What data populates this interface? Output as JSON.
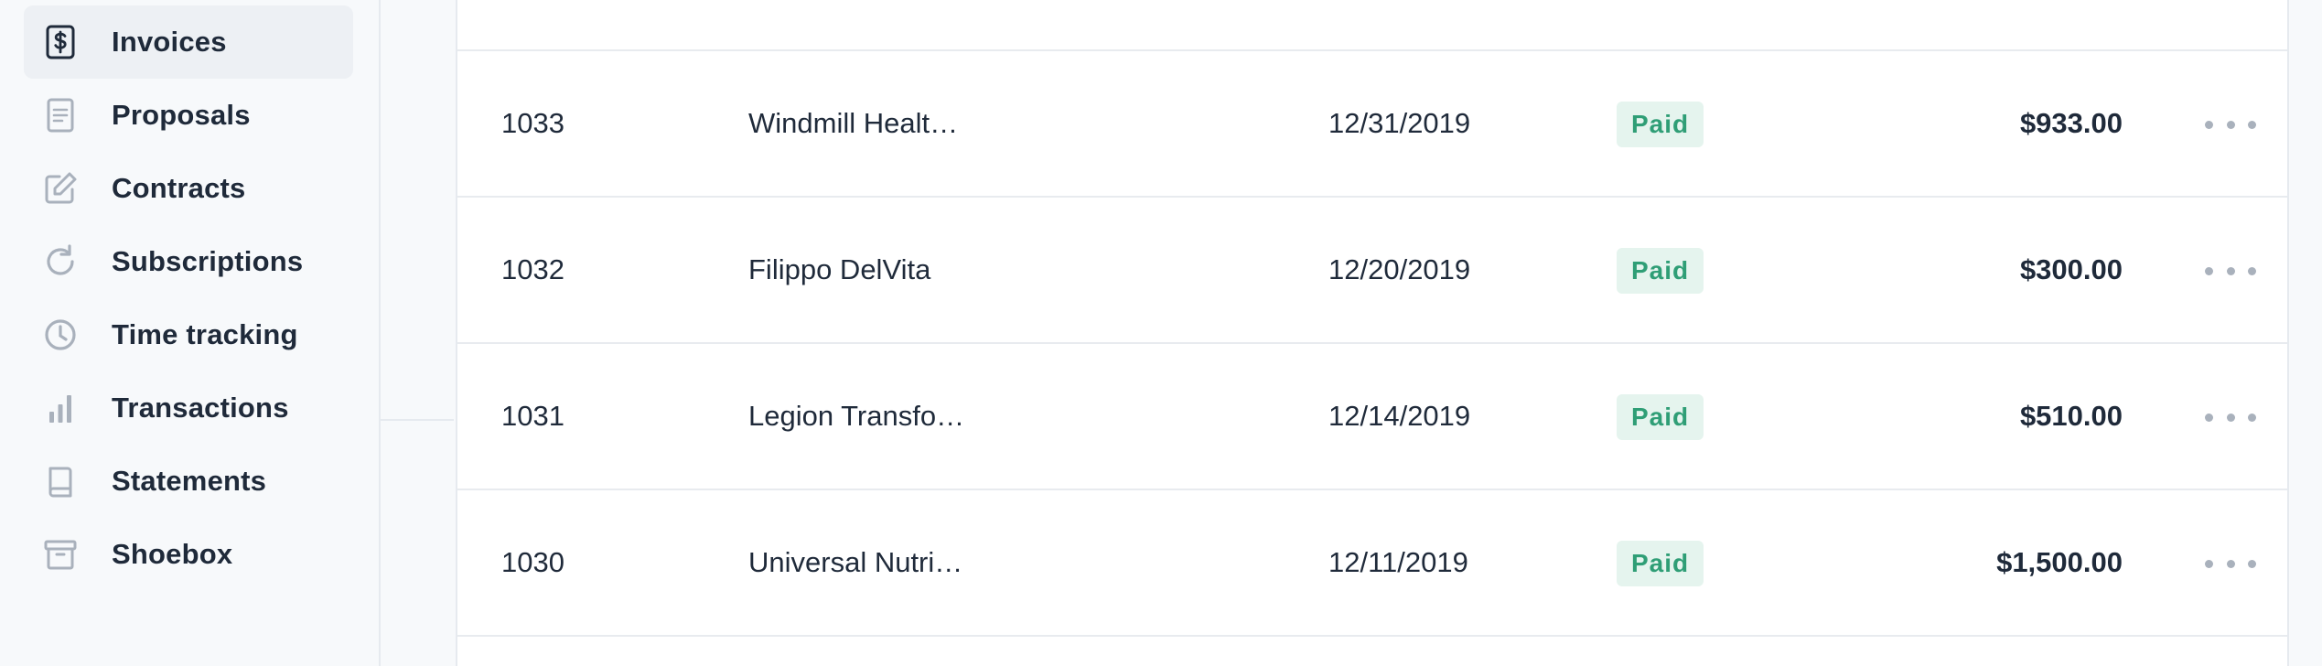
{
  "sidebar": {
    "items": [
      {
        "label": "Invoices",
        "icon": "dollar-document-icon",
        "active": true
      },
      {
        "label": "Proposals",
        "icon": "document-icon",
        "active": false
      },
      {
        "label": "Contracts",
        "icon": "edit-icon",
        "active": false
      },
      {
        "label": "Subscriptions",
        "icon": "refresh-icon",
        "active": false
      },
      {
        "label": "Time tracking",
        "icon": "clock-icon",
        "active": false
      },
      {
        "label": "Transactions",
        "icon": "bar-chart-icon",
        "active": false
      },
      {
        "label": "Statements",
        "icon": "book-icon",
        "active": false
      },
      {
        "label": "Shoebox",
        "icon": "archive-box-icon",
        "active": false
      }
    ]
  },
  "invoices": {
    "rows": [
      {
        "id": "1033",
        "client": "Windmill Healt…",
        "date": "12/31/2019",
        "status": "Paid",
        "amount": "$933.00"
      },
      {
        "id": "1032",
        "client": "Filippo DelVita",
        "date": "12/20/2019",
        "status": "Paid",
        "amount": "$300.00"
      },
      {
        "id": "1031",
        "client": "Legion Transfo…",
        "date": "12/14/2019",
        "status": "Paid",
        "amount": "$510.00"
      },
      {
        "id": "1030",
        "client": "Universal Nutri…",
        "date": "12/11/2019",
        "status": "Paid",
        "amount": "$1,500.00"
      }
    ]
  },
  "colors": {
    "status_paid_text": "#2f9e76",
    "status_paid_bg": "#e5f4ee",
    "icon_muted": "#a9b1bc",
    "text_primary": "#1f2a3a"
  }
}
